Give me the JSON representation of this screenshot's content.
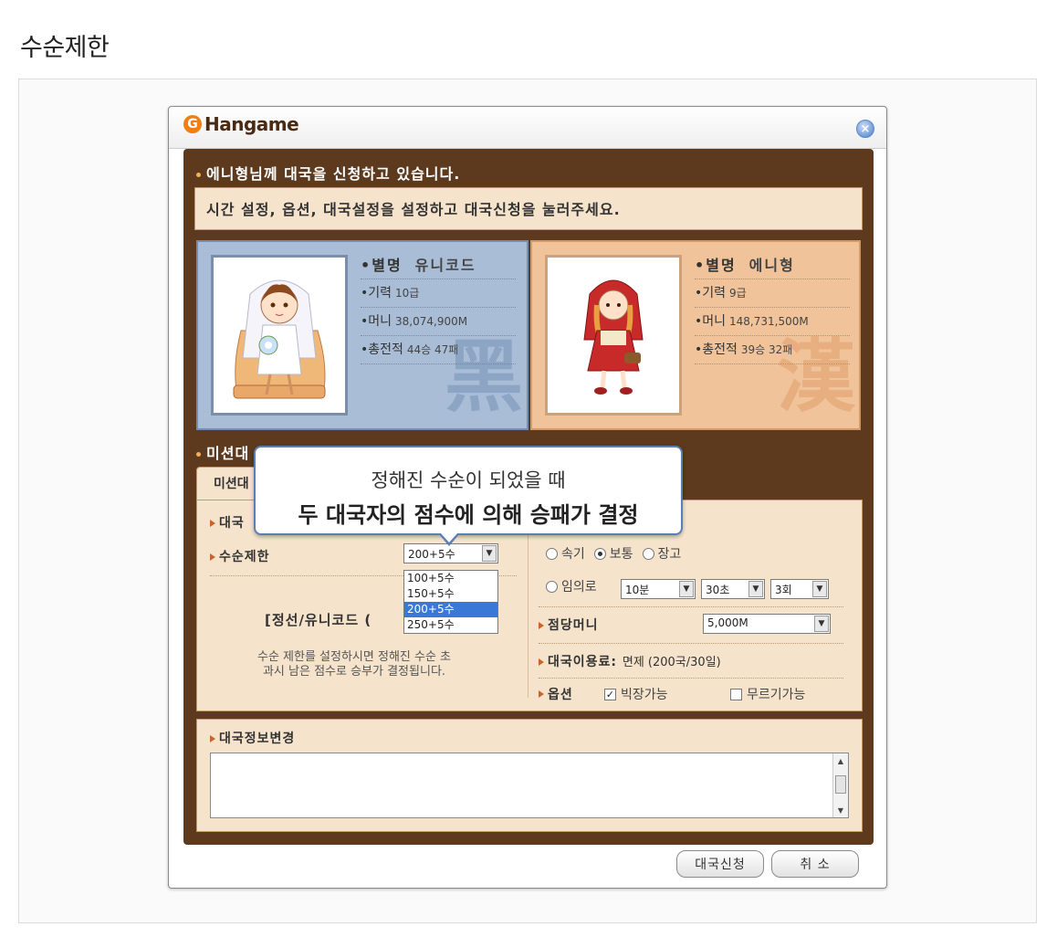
{
  "page": {
    "heading": "수순제한"
  },
  "dialog": {
    "logo_mark": "G",
    "logo_text": "Hangame",
    "close_glyph": "×",
    "header": "에니형님께 대국을 신청하고 있습니다.",
    "instruction": "시간 설정, 옵션, 대국설정을 설정하고 대국신청을 눌러주세요.",
    "players": [
      {
        "name_label": "•별명",
        "name": "유니코드",
        "rank_label": "•기력",
        "rank": "10급",
        "money_label": "•머니",
        "money": "38,074,900M",
        "record_label": "•총전적",
        "record": "44승 47패",
        "watermark": "黑"
      },
      {
        "name_label": "•별명",
        "name": "에니형",
        "rank_label": "•기력",
        "rank": "9급",
        "money_label": "•머니",
        "money": "148,731,500M",
        "record_label": "•총전적",
        "record": "39승 32패",
        "watermark": "漢"
      }
    ],
    "mission_title": "미션대",
    "tab_label": "미션대",
    "rows": {
      "game_type_label": "대국",
      "move_limit_label": "수순제한",
      "move_limit_value": "200+5수",
      "move_limit_options": [
        "100+5수",
        "150+5수",
        "200+5수",
        "250+5수"
      ],
      "rule_text": "[정선/유니코드 (",
      "note": "수순 제한를 설정하시면 정해진 수순 초\n과시 남은 점수로 승부가 결정됩니다.",
      "time_options": [
        "속기",
        "보통",
        "장고"
      ],
      "time_selected": "보통",
      "custom_label": "임의로",
      "custom_time": "10분",
      "custom_sec": "30초",
      "custom_count": "3회",
      "bet_label": "점당머니",
      "bet_value": "5,000M",
      "fee_label": "대국이용료:",
      "fee_value": "면제 (200국/30일)",
      "options_label": "옵션",
      "opt1": "빅장가능",
      "opt2": "무르기가능"
    },
    "info_title": "대국정보변경",
    "buttons": {
      "apply": "대국신청",
      "cancel": "취 소"
    }
  },
  "tooltip": {
    "line1": "정해진 수순이 되었을 때",
    "line2": "두 대국자의 점수에 의해 승패가 결정"
  }
}
